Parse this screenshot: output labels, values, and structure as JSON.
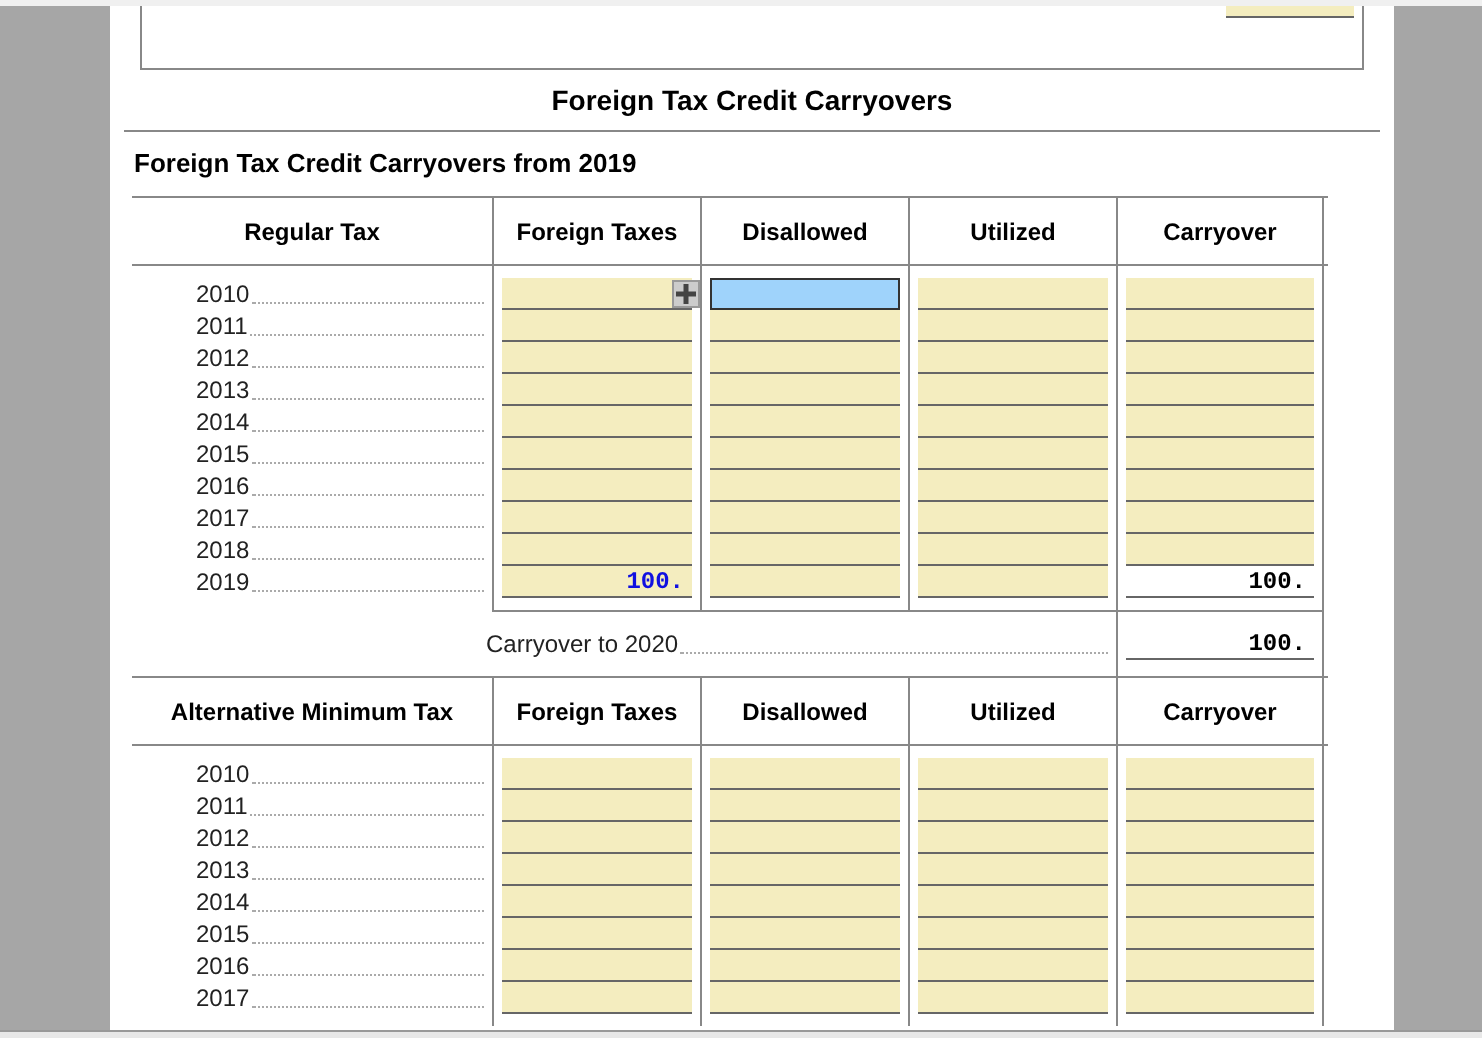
{
  "title": "Foreign Tax Credit Carryovers",
  "subtitle": "Foreign Tax Credit Carryovers from 2019",
  "sections": [
    {
      "header": "Regular Tax",
      "columns": [
        "Foreign Taxes",
        "Disallowed",
        "Utilized",
        "Carryover"
      ],
      "rows": [
        {
          "year": "2010",
          "cells": [
            {
              "kind": "input",
              "focused": false,
              "detail": true
            },
            {
              "kind": "input",
              "focused": true
            },
            {
              "kind": "input",
              "focused": false
            },
            {
              "kind": "input",
              "focused": false
            }
          ]
        },
        {
          "year": "2011",
          "cells": [
            {
              "kind": "input",
              "focused": false
            },
            {
              "kind": "input",
              "focused": false
            },
            {
              "kind": "input",
              "focused": false
            },
            {
              "kind": "input",
              "focused": false
            }
          ]
        },
        {
          "year": "2012",
          "cells": [
            {
              "kind": "input",
              "focused": false
            },
            {
              "kind": "input",
              "focused": false
            },
            {
              "kind": "input",
              "focused": false
            },
            {
              "kind": "input",
              "focused": false
            }
          ]
        },
        {
          "year": "2013",
          "cells": [
            {
              "kind": "input",
              "focused": false
            },
            {
              "kind": "input",
              "focused": false
            },
            {
              "kind": "input",
              "focused": false
            },
            {
              "kind": "input",
              "focused": false
            }
          ]
        },
        {
          "year": "2014",
          "cells": [
            {
              "kind": "input",
              "focused": false
            },
            {
              "kind": "input",
              "focused": false
            },
            {
              "kind": "input",
              "focused": false
            },
            {
              "kind": "input",
              "focused": false
            }
          ]
        },
        {
          "year": "2015",
          "cells": [
            {
              "kind": "input",
              "focused": false
            },
            {
              "kind": "input",
              "focused": false
            },
            {
              "kind": "input",
              "focused": false
            },
            {
              "kind": "input",
              "focused": false
            }
          ]
        },
        {
          "year": "2016",
          "cells": [
            {
              "kind": "input",
              "focused": false
            },
            {
              "kind": "input",
              "focused": false
            },
            {
              "kind": "input",
              "focused": false
            },
            {
              "kind": "input",
              "focused": false
            }
          ]
        },
        {
          "year": "2017",
          "cells": [
            {
              "kind": "input",
              "focused": false
            },
            {
              "kind": "input",
              "focused": false
            },
            {
              "kind": "input",
              "focused": false
            },
            {
              "kind": "input",
              "focused": false
            }
          ]
        },
        {
          "year": "2018",
          "cells": [
            {
              "kind": "input",
              "focused": false
            },
            {
              "kind": "input",
              "focused": false
            },
            {
              "kind": "input",
              "focused": false
            },
            {
              "kind": "input",
              "focused": false
            }
          ]
        },
        {
          "year": "2019",
          "cells": [
            {
              "kind": "input",
              "focused": false,
              "value": "100."
            },
            {
              "kind": "input",
              "focused": false
            },
            {
              "kind": "input",
              "focused": false
            },
            {
              "kind": "calculated",
              "focused": false,
              "value": "100."
            }
          ]
        }
      ],
      "total": {
        "label": "Carryover to 2020",
        "value": "100."
      }
    },
    {
      "header": "Alternative Minimum Tax",
      "columns": [
        "Foreign Taxes",
        "Disallowed",
        "Utilized",
        "Carryover"
      ],
      "rows": [
        {
          "year": "2010",
          "cells": [
            {
              "kind": "input",
              "focused": false
            },
            {
              "kind": "input",
              "focused": false
            },
            {
              "kind": "input",
              "focused": false
            },
            {
              "kind": "input",
              "focused": false
            }
          ]
        },
        {
          "year": "2011",
          "cells": [
            {
              "kind": "input",
              "focused": false
            },
            {
              "kind": "input",
              "focused": false
            },
            {
              "kind": "input",
              "focused": false
            },
            {
              "kind": "input",
              "focused": false
            }
          ]
        },
        {
          "year": "2012",
          "cells": [
            {
              "kind": "input",
              "focused": false
            },
            {
              "kind": "input",
              "focused": false
            },
            {
              "kind": "input",
              "focused": false
            },
            {
              "kind": "input",
              "focused": false
            }
          ]
        },
        {
          "year": "2013",
          "cells": [
            {
              "kind": "input",
              "focused": false
            },
            {
              "kind": "input",
              "focused": false
            },
            {
              "kind": "input",
              "focused": false
            },
            {
              "kind": "input",
              "focused": false
            }
          ]
        },
        {
          "year": "2014",
          "cells": [
            {
              "kind": "input",
              "focused": false
            },
            {
              "kind": "input",
              "focused": false
            },
            {
              "kind": "input",
              "focused": false
            },
            {
              "kind": "input",
              "focused": false
            }
          ]
        },
        {
          "year": "2015",
          "cells": [
            {
              "kind": "input",
              "focused": false
            },
            {
              "kind": "input",
              "focused": false
            },
            {
              "kind": "input",
              "focused": false
            },
            {
              "kind": "input",
              "focused": false
            }
          ]
        },
        {
          "year": "2016",
          "cells": [
            {
              "kind": "input",
              "focused": false
            },
            {
              "kind": "input",
              "focused": false
            },
            {
              "kind": "input",
              "focused": false
            },
            {
              "kind": "input",
              "focused": false
            }
          ]
        },
        {
          "year": "2017",
          "cells": [
            {
              "kind": "input",
              "focused": false
            },
            {
              "kind": "input",
              "focused": false
            },
            {
              "kind": "input",
              "focused": false
            },
            {
              "kind": "input",
              "focused": false
            }
          ]
        }
      ]
    }
  ]
}
